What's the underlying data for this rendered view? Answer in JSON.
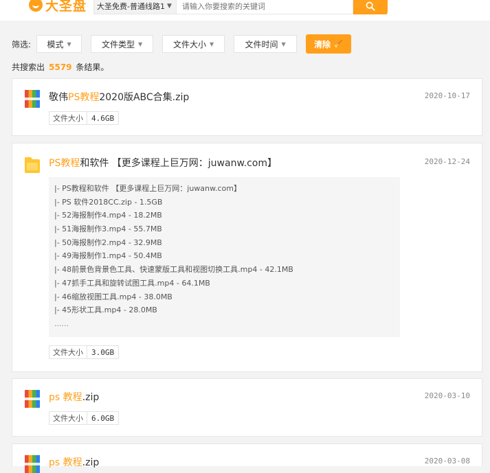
{
  "header": {
    "logo_text": "大圣盘",
    "search_select": "大圣免费-普通线路1",
    "search_placeholder": "请输入你要搜索的关键词",
    "search_button_icon": "search-icon"
  },
  "filters": {
    "label": "筛选:",
    "items": [
      "模式",
      "文件类型",
      "文件大小",
      "文件时间"
    ],
    "clear_label": "清除"
  },
  "results": {
    "prefix": "共搜索出",
    "count": "5579",
    "suffix": "条结果。"
  },
  "cards": [
    {
      "icon": "archive-icon",
      "title_pre": "敬伟",
      "title_hl": "PS教程",
      "title_post": "2020版ABC合集.zip",
      "date": "2020-10-17",
      "size_key": "文件大小",
      "size_val": "4.6GB"
    },
    {
      "icon": "folder-icon",
      "title_pre": "",
      "title_hl": "PS教程",
      "title_post": "和软件 【更多课程上巨万网：juwanw.com】",
      "date": "2020-12-24",
      "files": [
        "|- PS教程和软件 【更多课程上巨万网：juwanw.com】",
        "|- PS 软件2018CC.zip - 1.5GB",
        "|- 52海报制作4.mp4 - 18.2MB",
        "|- 51海报制作3.mp4 - 55.7MB",
        "|- 50海报制作2.mp4 - 32.9MB",
        "|- 49海报制作1.mp4 - 50.4MB",
        "|- 48前景色背景色工具、快速蒙版工具和视图切换工具.mp4 - 42.1MB",
        "|- 47抓手工具和旋转试图工具.mp4 - 64.1MB",
        "|- 46缩放视图工具.mp4 - 38.0MB",
        "|- 45形状工具.mp4 - 28.0MB"
      ],
      "more": "......",
      "size_key": "文件大小",
      "size_val": "3.0GB"
    },
    {
      "icon": "archive-icon",
      "title_pre": "",
      "title_hl": "ps 教程",
      "title_post": ".zip",
      "date": "2020-03-10",
      "size_key": "文件大小",
      "size_val": "6.0GB"
    },
    {
      "icon": "archive-icon",
      "title_pre": "",
      "title_hl": "ps 教程",
      "title_post": ".zip",
      "date": "2020-03-08"
    }
  ]
}
